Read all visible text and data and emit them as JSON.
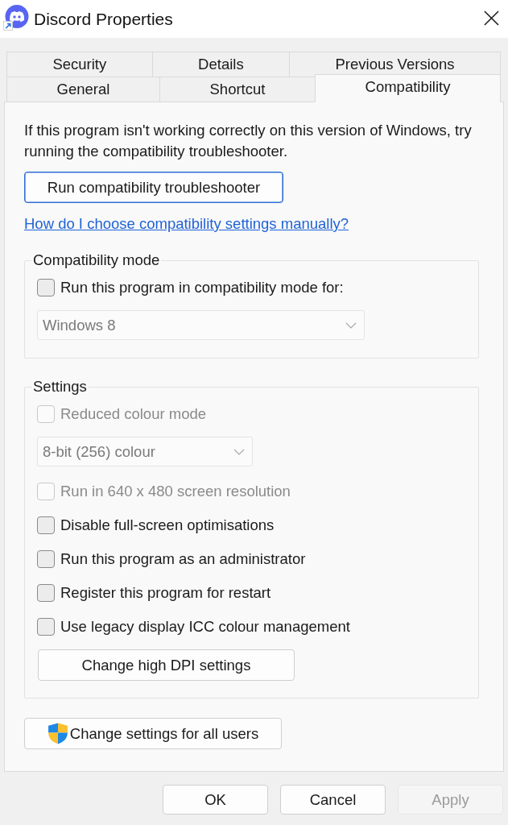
{
  "window": {
    "title": "Discord Properties"
  },
  "tab_rows": [
    {
      "tabs": [
        {
          "label": "Security",
          "selected": false
        },
        {
          "label": "Details",
          "selected": false
        },
        {
          "label": "Previous Versions",
          "selected": false
        }
      ]
    },
    {
      "tabs": [
        {
          "label": "General",
          "selected": false
        },
        {
          "label": "Shortcut",
          "selected": false
        },
        {
          "label": "Compatibility",
          "selected": true
        }
      ]
    }
  ],
  "intro": "If this program isn't working correctly on this version of Windows, try running the compatibility troubleshooter.",
  "troubleshooter_button": {
    "label": "Run compatibility troubleshooter",
    "focused": true
  },
  "help_link": "How do I choose compatibility settings manually?",
  "groups": [
    {
      "title": "Compatibility mode",
      "items": [
        {
          "kind": "checkbox",
          "label": "Run this program in compatibility mode for:",
          "checked": false,
          "disabled": false
        },
        {
          "kind": "dropdown",
          "value": "Windows 8",
          "disabled": true
        }
      ]
    },
    {
      "title": "Settings",
      "items": [
        {
          "kind": "checkbox",
          "label": "Reduced colour mode",
          "checked": false,
          "disabled": true
        },
        {
          "kind": "dropdown",
          "value": "8-bit (256) colour",
          "disabled": true
        },
        {
          "kind": "checkbox",
          "label": "Run in 640 x 480 screen resolution",
          "checked": false,
          "disabled": true
        },
        {
          "kind": "checkbox",
          "label": "Disable full-screen optimisations",
          "checked": false,
          "disabled": false
        },
        {
          "kind": "checkbox",
          "label": "Run this program as an administrator",
          "checked": false,
          "disabled": false
        },
        {
          "kind": "checkbox",
          "label": "Register this program for restart",
          "checked": false,
          "disabled": false
        },
        {
          "kind": "checkbox",
          "label": "Use legacy display ICC colour management",
          "checked": false,
          "disabled": false
        },
        {
          "kind": "button",
          "label": "Change high DPI settings"
        }
      ]
    }
  ],
  "all_users_button": {
    "label": "Change settings for all users"
  },
  "dialog_buttons": [
    {
      "label": "OK",
      "disabled": false
    },
    {
      "label": "Cancel",
      "disabled": false
    },
    {
      "label": "Apply",
      "disabled": true
    }
  ]
}
